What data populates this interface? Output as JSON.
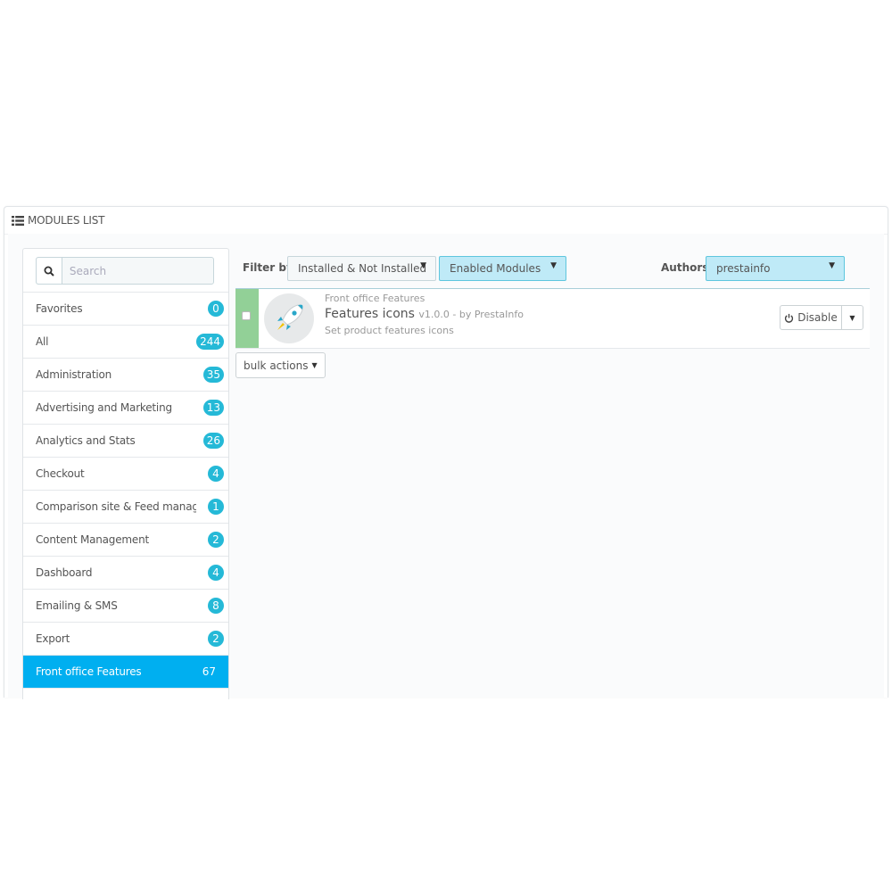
{
  "panel": {
    "title": "MODULES LIST",
    "icon": "list-icon"
  },
  "search": {
    "placeholder": "Search",
    "icon": "search-icon"
  },
  "categories": [
    {
      "label": "Favorites",
      "count": "0"
    },
    {
      "label": "All",
      "count": "244"
    },
    {
      "label": "Administration",
      "count": "35"
    },
    {
      "label": "Advertising and Marketing",
      "count": "13"
    },
    {
      "label": "Analytics and Stats",
      "count": "26"
    },
    {
      "label": "Checkout",
      "count": "4"
    },
    {
      "label": "Comparison site & Feed manag...",
      "count": "1"
    },
    {
      "label": "Content Management",
      "count": "2"
    },
    {
      "label": "Dashboard",
      "count": "4"
    },
    {
      "label": "Emailing & SMS",
      "count": "8"
    },
    {
      "label": "Export",
      "count": "2"
    },
    {
      "label": "Front office Features",
      "count": "67",
      "active": true
    }
  ],
  "filter": {
    "label": "Filter by",
    "install_select": "Installed & Not Installed",
    "status_select": "Enabled Modules",
    "authors_label": "Authors",
    "authors_select": "prestainfo"
  },
  "module": {
    "category": "Front office Features",
    "name": "Features icons",
    "version": "v1.0.0 - by PrestaInfo",
    "description": "Set product features icons",
    "disable_label": "Disable",
    "status_color": "#92d097",
    "logo_icon": "rocket-icon"
  },
  "bulk_actions_label": "bulk actions",
  "colors": {
    "accent": "#25b9d7",
    "active": "#00aff0",
    "highlight": "#bfeaf7"
  }
}
